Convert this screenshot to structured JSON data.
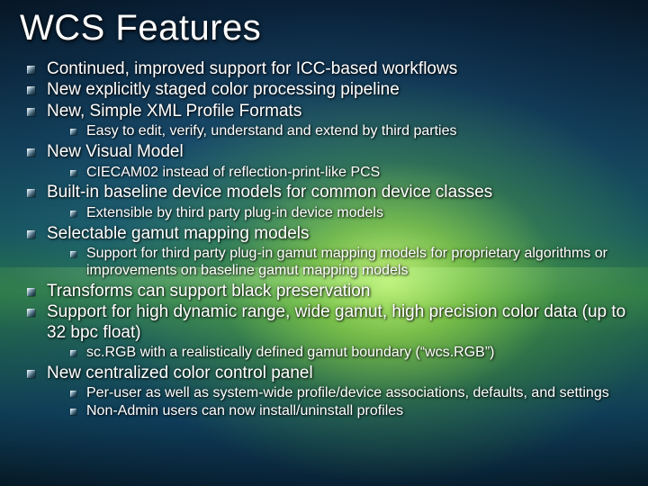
{
  "title": "WCS Features",
  "items": [
    {
      "text": "Continued, improved support for ICC-based workflows"
    },
    {
      "text": "New explicitly staged color processing pipeline"
    },
    {
      "text": "New, Simple XML Profile Formats",
      "children": [
        {
          "text": "Easy to edit, verify, understand and extend by third parties"
        }
      ]
    },
    {
      "text": "New Visual Model",
      "children": [
        {
          "text": "CIECAM02 instead of reflection-print-like PCS"
        }
      ]
    },
    {
      "text": "Built-in baseline device models for common device classes",
      "children": [
        {
          "text": "Extensible by third party plug-in device models"
        }
      ]
    },
    {
      "text": "Selectable gamut mapping models",
      "children": [
        {
          "text": "Support for third party plug-in gamut mapping models for proprietary algorithms or improvements on baseline gamut mapping models"
        }
      ]
    },
    {
      "text": "Transforms can support black preservation"
    },
    {
      "text": "Support for high dynamic range, wide gamut, high precision color data (up to 32 bpc float)",
      "children": [
        {
          "text": "sc.RGB with a realistically defined gamut boundary (“wcs.RGB”)"
        }
      ]
    },
    {
      "text": "New centralized color control panel",
      "children": [
        {
          "text": "Per-user as well as system-wide profile/device associations, defaults, and settings"
        },
        {
          "text": "Non-Admin users can now install/uninstall profiles"
        }
      ]
    }
  ]
}
